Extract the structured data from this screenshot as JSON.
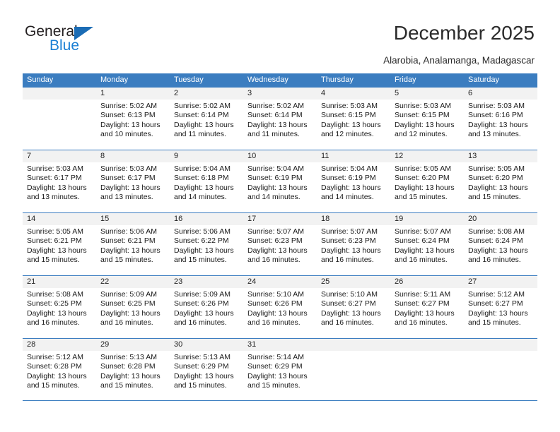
{
  "brand": {
    "name_part1": "General",
    "name_part2": "Blue",
    "accent_color": "#1b7fd4",
    "triangle_color": "#1b6cb5"
  },
  "header": {
    "title": "December 2025",
    "subtitle": "Alarobia, Analamanga, Madagascar"
  },
  "calendar": {
    "header_bg": "#3b7dc0",
    "daynum_bg": "#f2f2f2",
    "weekdays": [
      "Sunday",
      "Monday",
      "Tuesday",
      "Wednesday",
      "Thursday",
      "Friday",
      "Saturday"
    ],
    "weeks": [
      [
        {
          "day": "",
          "sunrise": "",
          "sunset": "",
          "daylight1": "",
          "daylight2": ""
        },
        {
          "day": "1",
          "sunrise": "Sunrise: 5:02 AM",
          "sunset": "Sunset: 6:13 PM",
          "daylight1": "Daylight: 13 hours",
          "daylight2": "and 10 minutes."
        },
        {
          "day": "2",
          "sunrise": "Sunrise: 5:02 AM",
          "sunset": "Sunset: 6:14 PM",
          "daylight1": "Daylight: 13 hours",
          "daylight2": "and 11 minutes."
        },
        {
          "day": "3",
          "sunrise": "Sunrise: 5:02 AM",
          "sunset": "Sunset: 6:14 PM",
          "daylight1": "Daylight: 13 hours",
          "daylight2": "and 11 minutes."
        },
        {
          "day": "4",
          "sunrise": "Sunrise: 5:03 AM",
          "sunset": "Sunset: 6:15 PM",
          "daylight1": "Daylight: 13 hours",
          "daylight2": "and 12 minutes."
        },
        {
          "day": "5",
          "sunrise": "Sunrise: 5:03 AM",
          "sunset": "Sunset: 6:15 PM",
          "daylight1": "Daylight: 13 hours",
          "daylight2": "and 12 minutes."
        },
        {
          "day": "6",
          "sunrise": "Sunrise: 5:03 AM",
          "sunset": "Sunset: 6:16 PM",
          "daylight1": "Daylight: 13 hours",
          "daylight2": "and 13 minutes."
        }
      ],
      [
        {
          "day": "7",
          "sunrise": "Sunrise: 5:03 AM",
          "sunset": "Sunset: 6:17 PM",
          "daylight1": "Daylight: 13 hours",
          "daylight2": "and 13 minutes."
        },
        {
          "day": "8",
          "sunrise": "Sunrise: 5:03 AM",
          "sunset": "Sunset: 6:17 PM",
          "daylight1": "Daylight: 13 hours",
          "daylight2": "and 13 minutes."
        },
        {
          "day": "9",
          "sunrise": "Sunrise: 5:04 AM",
          "sunset": "Sunset: 6:18 PM",
          "daylight1": "Daylight: 13 hours",
          "daylight2": "and 14 minutes."
        },
        {
          "day": "10",
          "sunrise": "Sunrise: 5:04 AM",
          "sunset": "Sunset: 6:19 PM",
          "daylight1": "Daylight: 13 hours",
          "daylight2": "and 14 minutes."
        },
        {
          "day": "11",
          "sunrise": "Sunrise: 5:04 AM",
          "sunset": "Sunset: 6:19 PM",
          "daylight1": "Daylight: 13 hours",
          "daylight2": "and 14 minutes."
        },
        {
          "day": "12",
          "sunrise": "Sunrise: 5:05 AM",
          "sunset": "Sunset: 6:20 PM",
          "daylight1": "Daylight: 13 hours",
          "daylight2": "and 15 minutes."
        },
        {
          "day": "13",
          "sunrise": "Sunrise: 5:05 AM",
          "sunset": "Sunset: 6:20 PM",
          "daylight1": "Daylight: 13 hours",
          "daylight2": "and 15 minutes."
        }
      ],
      [
        {
          "day": "14",
          "sunrise": "Sunrise: 5:05 AM",
          "sunset": "Sunset: 6:21 PM",
          "daylight1": "Daylight: 13 hours",
          "daylight2": "and 15 minutes."
        },
        {
          "day": "15",
          "sunrise": "Sunrise: 5:06 AM",
          "sunset": "Sunset: 6:21 PM",
          "daylight1": "Daylight: 13 hours",
          "daylight2": "and 15 minutes."
        },
        {
          "day": "16",
          "sunrise": "Sunrise: 5:06 AM",
          "sunset": "Sunset: 6:22 PM",
          "daylight1": "Daylight: 13 hours",
          "daylight2": "and 15 minutes."
        },
        {
          "day": "17",
          "sunrise": "Sunrise: 5:07 AM",
          "sunset": "Sunset: 6:23 PM",
          "daylight1": "Daylight: 13 hours",
          "daylight2": "and 16 minutes."
        },
        {
          "day": "18",
          "sunrise": "Sunrise: 5:07 AM",
          "sunset": "Sunset: 6:23 PM",
          "daylight1": "Daylight: 13 hours",
          "daylight2": "and 16 minutes."
        },
        {
          "day": "19",
          "sunrise": "Sunrise: 5:07 AM",
          "sunset": "Sunset: 6:24 PM",
          "daylight1": "Daylight: 13 hours",
          "daylight2": "and 16 minutes."
        },
        {
          "day": "20",
          "sunrise": "Sunrise: 5:08 AM",
          "sunset": "Sunset: 6:24 PM",
          "daylight1": "Daylight: 13 hours",
          "daylight2": "and 16 minutes."
        }
      ],
      [
        {
          "day": "21",
          "sunrise": "Sunrise: 5:08 AM",
          "sunset": "Sunset: 6:25 PM",
          "daylight1": "Daylight: 13 hours",
          "daylight2": "and 16 minutes."
        },
        {
          "day": "22",
          "sunrise": "Sunrise: 5:09 AM",
          "sunset": "Sunset: 6:25 PM",
          "daylight1": "Daylight: 13 hours",
          "daylight2": "and 16 minutes."
        },
        {
          "day": "23",
          "sunrise": "Sunrise: 5:09 AM",
          "sunset": "Sunset: 6:26 PM",
          "daylight1": "Daylight: 13 hours",
          "daylight2": "and 16 minutes."
        },
        {
          "day": "24",
          "sunrise": "Sunrise: 5:10 AM",
          "sunset": "Sunset: 6:26 PM",
          "daylight1": "Daylight: 13 hours",
          "daylight2": "and 16 minutes."
        },
        {
          "day": "25",
          "sunrise": "Sunrise: 5:10 AM",
          "sunset": "Sunset: 6:27 PM",
          "daylight1": "Daylight: 13 hours",
          "daylight2": "and 16 minutes."
        },
        {
          "day": "26",
          "sunrise": "Sunrise: 5:11 AM",
          "sunset": "Sunset: 6:27 PM",
          "daylight1": "Daylight: 13 hours",
          "daylight2": "and 16 minutes."
        },
        {
          "day": "27",
          "sunrise": "Sunrise: 5:12 AM",
          "sunset": "Sunset: 6:27 PM",
          "daylight1": "Daylight: 13 hours",
          "daylight2": "and 15 minutes."
        }
      ],
      [
        {
          "day": "28",
          "sunrise": "Sunrise: 5:12 AM",
          "sunset": "Sunset: 6:28 PM",
          "daylight1": "Daylight: 13 hours",
          "daylight2": "and 15 minutes."
        },
        {
          "day": "29",
          "sunrise": "Sunrise: 5:13 AM",
          "sunset": "Sunset: 6:28 PM",
          "daylight1": "Daylight: 13 hours",
          "daylight2": "and 15 minutes."
        },
        {
          "day": "30",
          "sunrise": "Sunrise: 5:13 AM",
          "sunset": "Sunset: 6:29 PM",
          "daylight1": "Daylight: 13 hours",
          "daylight2": "and 15 minutes."
        },
        {
          "day": "31",
          "sunrise": "Sunrise: 5:14 AM",
          "sunset": "Sunset: 6:29 PM",
          "daylight1": "Daylight: 13 hours",
          "daylight2": "and 15 minutes."
        },
        {
          "day": "",
          "sunrise": "",
          "sunset": "",
          "daylight1": "",
          "daylight2": ""
        },
        {
          "day": "",
          "sunrise": "",
          "sunset": "",
          "daylight1": "",
          "daylight2": ""
        },
        {
          "day": "",
          "sunrise": "",
          "sunset": "",
          "daylight1": "",
          "daylight2": ""
        }
      ]
    ]
  }
}
